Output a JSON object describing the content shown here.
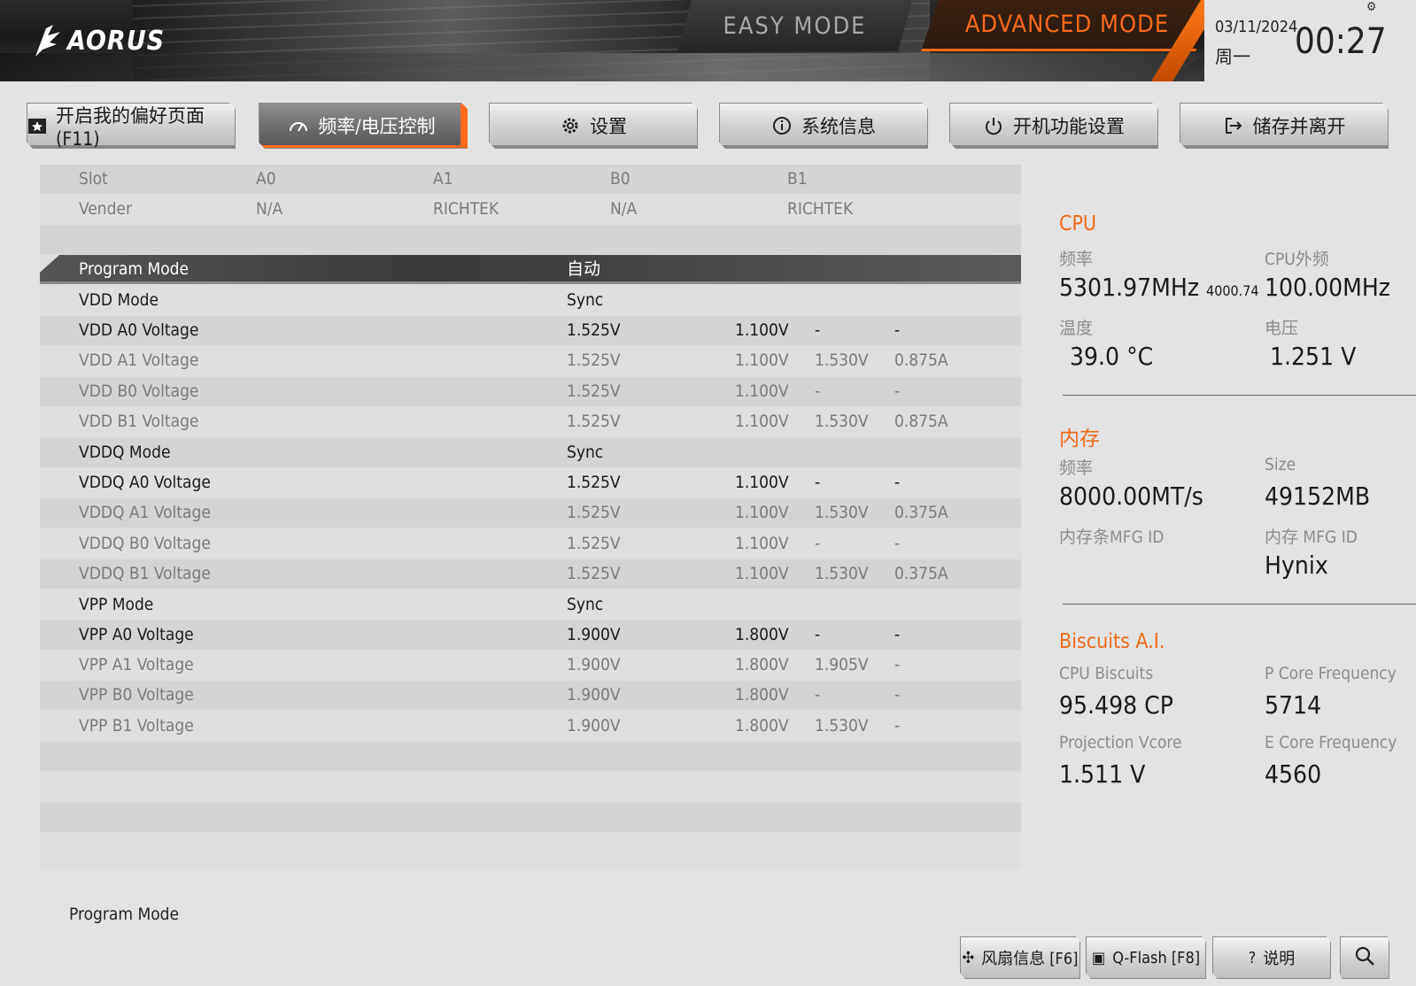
{
  "header": {
    "logo_text": "AORUS",
    "easy_mode": "EASY MODE",
    "advanced_mode": "ADVANCED MODE",
    "date": "03/11/2024",
    "weekday": "周一",
    "time": "00:27"
  },
  "tabs": [
    {
      "label": "开启我的偏好页面 (F11)",
      "icon": "star-page-icon"
    },
    {
      "label": "频率/电压控制",
      "icon": "gauge-icon"
    },
    {
      "label": "设置",
      "icon": "gear-icon"
    },
    {
      "label": "系统信息",
      "icon": "info-icon"
    },
    {
      "label": "开机功能设置",
      "icon": "power-icon"
    },
    {
      "label": "储存并离开",
      "icon": "exit-icon"
    }
  ],
  "slot_header": {
    "slot": {
      "c0": "Slot",
      "c1": "A0",
      "c2": "A1",
      "c3": "B0",
      "c4": "B1"
    },
    "vender": {
      "c0": "Vender",
      "c1": "N/A",
      "c2": "RICHTEK",
      "c3": "N/A",
      "c4": "RICHTEK"
    }
  },
  "settings": [
    {
      "name": "Program Mode",
      "value": "自动",
      "v2": "",
      "v3": "",
      "v4": ""
    },
    {
      "name": "VDD Mode",
      "value": "Sync",
      "v2": "",
      "v3": "",
      "v4": ""
    },
    {
      "name": "VDD A0 Voltage",
      "value": "1.525V",
      "v2": "1.100V",
      "v3": "-",
      "v4": "-"
    },
    {
      "name": "VDD A1 Voltage",
      "value": "1.525V",
      "v2": "1.100V",
      "v3": "1.530V",
      "v4": "0.875A"
    },
    {
      "name": "VDD B0 Voltage",
      "value": "1.525V",
      "v2": "1.100V",
      "v3": "-",
      "v4": "-"
    },
    {
      "name": "VDD B1 Voltage",
      "value": "1.525V",
      "v2": "1.100V",
      "v3": "1.530V",
      "v4": "0.875A"
    },
    {
      "name": "VDDQ Mode",
      "value": "Sync",
      "v2": "",
      "v3": "",
      "v4": ""
    },
    {
      "name": "VDDQ A0 Voltage",
      "value": "1.525V",
      "v2": "1.100V",
      "v3": "-",
      "v4": "-"
    },
    {
      "name": "VDDQ A1 Voltage",
      "value": "1.525V",
      "v2": "1.100V",
      "v3": "1.530V",
      "v4": "0.375A"
    },
    {
      "name": "VDDQ B0 Voltage",
      "value": "1.525V",
      "v2": "1.100V",
      "v3": "-",
      "v4": "-"
    },
    {
      "name": "VDDQ B1 Voltage",
      "value": "1.525V",
      "v2": "1.100V",
      "v3": "1.530V",
      "v4": "0.375A"
    },
    {
      "name": "VPP Mode",
      "value": "Sync",
      "v2": "",
      "v3": "",
      "v4": ""
    },
    {
      "name": "VPP A0 Voltage",
      "value": "1.900V",
      "v2": "1.800V",
      "v3": "-",
      "v4": "-"
    },
    {
      "name": "VPP A1 Voltage",
      "value": "1.900V",
      "v2": "1.800V",
      "v3": "1.905V",
      "v4": "-"
    },
    {
      "name": "VPP B0 Voltage",
      "value": "1.900V",
      "v2": "1.800V",
      "v3": "-",
      "v4": "-"
    },
    {
      "name": "VPP B1 Voltage",
      "value": "1.900V",
      "v2": "1.800V",
      "v3": "1.530V",
      "v4": "-"
    }
  ],
  "info": {
    "cpu": {
      "title": "CPU",
      "freq_label": "频率",
      "freq_value": "5301.97MHz",
      "freq_sub": "4000.74",
      "bclk_label": "CPU外频",
      "bclk_value": "100.00MHz",
      "temp_label": "温度",
      "temp_value": "39.0 °C",
      "volt_label": "电压",
      "volt_value": "1.251 V"
    },
    "memory": {
      "title": "内存",
      "freq_label": "频率",
      "freq_value": "8000.00MT/s",
      "size_label": "Size",
      "size_value": "49152MB",
      "stick_mfg_label": "内存条MFG ID",
      "mfg_label": "内存 MFG ID",
      "mfg_value": "Hynix"
    },
    "biscuits": {
      "title": "Biscuits A.I.",
      "cpu_label": "CPU Biscuits",
      "cpu_value": "95.498 CP",
      "pcore_label": "P Core Frequency",
      "pcore_value": "5714",
      "vcore_label": "Projection Vcore",
      "vcore_value": "1.511 V",
      "ecore_label": "E Core Frequency",
      "ecore_value": "4560"
    }
  },
  "footer": {
    "help": "Program Mode",
    "fan_label": "风扇信息 [F6]",
    "qflash_label": "Q-Flash [F8]",
    "help_label": "说明"
  },
  "colors": {
    "accent": "#f06a1c",
    "background": "#e3e3e3"
  }
}
